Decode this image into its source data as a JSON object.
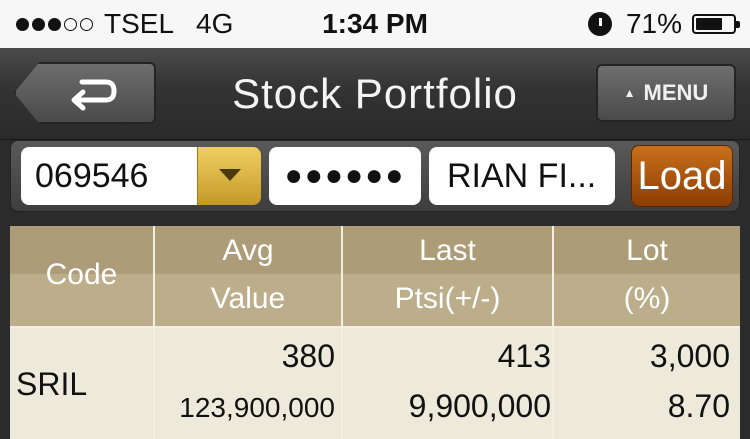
{
  "status_bar": {
    "signal_dots": [
      "filled",
      "filled",
      "filled",
      "empty",
      "empty"
    ],
    "carrier": "TSEL",
    "network": "4G",
    "time": "1:34 PM",
    "battery_percent": "71%",
    "battery_level": 0.71
  },
  "nav": {
    "title": "Stock Portfolio",
    "menu_label": "MENU"
  },
  "filter": {
    "account_value": "069546",
    "password_mask": "●●●●●●",
    "name_value": "RIAN FI...",
    "load_label": "Load"
  },
  "table": {
    "headers": {
      "code": "Code",
      "avg_top": "Avg",
      "avg_bottom": "Value",
      "last_top": "Last",
      "last_bottom": "Ptsi(+/-)",
      "lot_top": "Lot",
      "lot_bottom": "(%)"
    },
    "rows": [
      {
        "code": "SRIL",
        "avg": "380",
        "value": "123,900,000",
        "last": "413",
        "ptsi": "9,900,000",
        "lot": "3,000",
        "pct": "8.70"
      }
    ]
  },
  "colors": {
    "accent_load": "#b35a0f",
    "dropdown_gold": "#d8b03e",
    "table_header": "#ad9c78",
    "table_body": "#eeeadb"
  }
}
